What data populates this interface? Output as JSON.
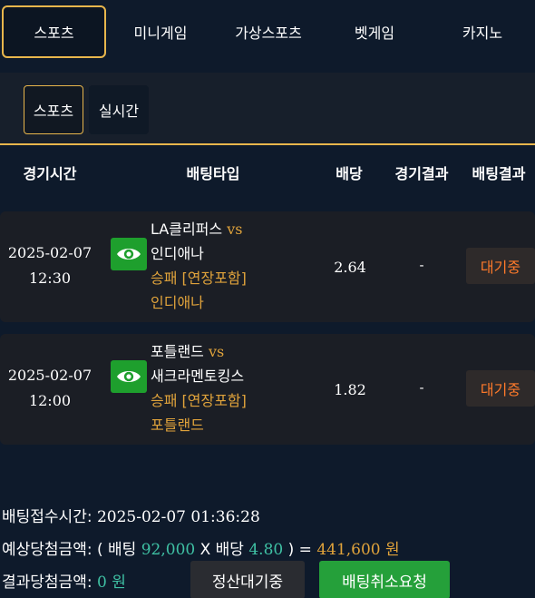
{
  "top_tabs": [
    {
      "label": "스포츠",
      "active": true
    },
    {
      "label": "미니게임",
      "active": false
    },
    {
      "label": "가상스포츠",
      "active": false
    },
    {
      "label": "벳게임",
      "active": false
    },
    {
      "label": "카지노",
      "active": false
    }
  ],
  "sub_tabs": [
    {
      "label": "스포츠",
      "active": true
    },
    {
      "label": "실시간",
      "active": false
    }
  ],
  "table": {
    "headers": [
      "경기시간",
      "배팅타입",
      "배당",
      "경기결과",
      "배팅결과"
    ],
    "rows": [
      {
        "date": "2025-02-07",
        "time": "12:30",
        "home": "LA클리퍼스",
        "vs": "vs",
        "away": "인디애나",
        "market": "승패 [연장포함]",
        "pick": "인디애나",
        "odds": "2.64",
        "result": "-",
        "status": "대기중",
        "icon": "eye-icon"
      },
      {
        "date": "2025-02-07",
        "time": "12:00",
        "home": "포틀랜드",
        "vs": "vs",
        "away": "새크라멘토킹스",
        "market": "승패 [연장포함]",
        "pick": "포틀랜드",
        "odds": "1.82",
        "result": "-",
        "status": "대기중",
        "icon": "eye-icon"
      }
    ]
  },
  "summary": {
    "received_label": "배팅접수시간:",
    "received_value": "2025-02-07 01:36:28",
    "expected_label": "예상당첨금액:",
    "open_paren": "(",
    "bet_label": "배팅",
    "bet_amount": "92,000",
    "times": "X",
    "odds_label": "배당",
    "total_odds": "4.80",
    "close_paren": ")",
    "equals": "=",
    "expected_amount": "441,600",
    "won": "원",
    "result_label": "결과당첨금액:",
    "result_amount": "0",
    "result_won": "원"
  },
  "buttons": {
    "pending": "정산대기중",
    "cancel": "배팅취소요청"
  },
  "colors": {
    "background": "#0e1a2b",
    "accent": "#e8b64c",
    "teal": "#3fc1a4",
    "orange": "#e0a33b",
    "status": "#ff7a2a",
    "green": "#25a03a"
  }
}
